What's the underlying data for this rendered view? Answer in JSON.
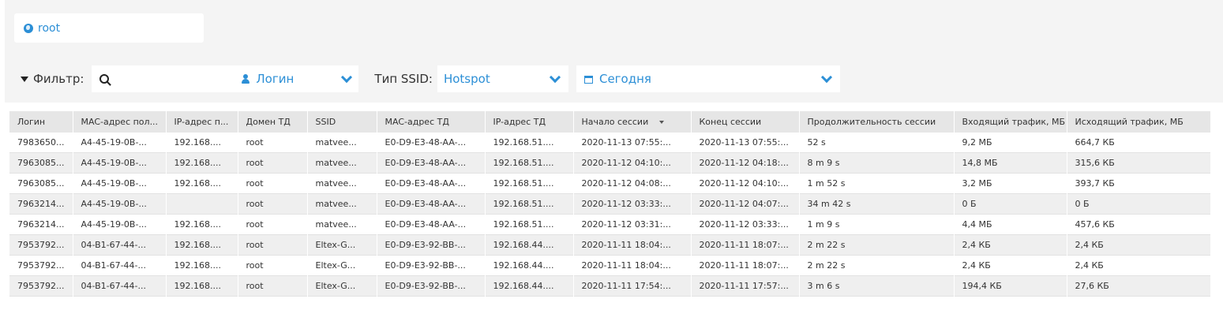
{
  "domain": {
    "label": "root"
  },
  "filter": {
    "label": "Фильтр:",
    "search_value": "",
    "login_selected": "Логин",
    "ssid_label": "Тип SSID:",
    "ssid_selected": "Hotspot",
    "date_selected": "Сегодня"
  },
  "accent_color": "#2c8fd6",
  "table": {
    "columns": [
      "Логин",
      "MAC-адрес пол...",
      "IP-адрес п...",
      "Домен ТД",
      "SSID",
      "MAC-адрес ТД",
      "IP-адрес ТД",
      "Начало сессии",
      "Конец сессии",
      "Продолжительность сессии",
      "Входящий трафик, МБ",
      "Исходящий трафик, МБ"
    ],
    "sorted_column": "Начало сессии",
    "rows": [
      [
        "7983650...",
        "A4-45-19-0B-...",
        "192.168....",
        "root",
        "matvee...",
        "E0-D9-E3-48-AA-...",
        "192.168.51....",
        "2020-11-13 07:55:...",
        "2020-11-13 07:55:...",
        "52 s",
        "9,2 МБ",
        "664,7 КБ"
      ],
      [
        "7963085...",
        "A4-45-19-0B-...",
        "192.168....",
        "root",
        "matvee...",
        "E0-D9-E3-48-AA-...",
        "192.168.51....",
        "2020-11-12 04:10:...",
        "2020-11-12 04:18:...",
        "8 m 9 s",
        "14,8 МБ",
        "315,6 КБ"
      ],
      [
        "7963085...",
        "A4-45-19-0B-...",
        "192.168....",
        "root",
        "matvee...",
        "E0-D9-E3-48-AA-...",
        "192.168.51....",
        "2020-11-12 04:08:...",
        "2020-11-12 04:10:...",
        "1 m 52 s",
        "3,2 МБ",
        "393,7 КБ"
      ],
      [
        "7963214...",
        "A4-45-19-0B-...",
        "",
        "root",
        "matvee...",
        "E0-D9-E3-48-AA-...",
        "192.168.51....",
        "2020-11-12 03:33:...",
        "2020-11-12 04:07:...",
        "34 m 42 s",
        "0 Б",
        "0 Б"
      ],
      [
        "7963214...",
        "A4-45-19-0B-...",
        "192.168....",
        "root",
        "matvee...",
        "E0-D9-E3-48-AA-...",
        "192.168.51....",
        "2020-11-12 03:31:...",
        "2020-11-12 03:33:...",
        "1 m 9 s",
        "4,4 МБ",
        "457,6 КБ"
      ],
      [
        "7953792...",
        "04-B1-67-44-...",
        "192.168....",
        "root",
        "Eltex-G...",
        "E0-D9-E3-92-BB-...",
        "192.168.44....",
        "2020-11-11 18:04:...",
        "2020-11-11 18:07:...",
        "2 m 22 s",
        "2,4 КБ",
        "2,4 КБ"
      ],
      [
        "7953792...",
        "04-B1-67-44-...",
        "192.168....",
        "root",
        "Eltex-G...",
        "E0-D9-E3-92-BB-...",
        "192.168.44....",
        "2020-11-11 18:04:...",
        "2020-11-11 18:07:...",
        "2 m 22 s",
        "2,4 КБ",
        "2,4 КБ"
      ],
      [
        "7953792...",
        "04-B1-67-44-...",
        "192.168....",
        "root",
        "Eltex-G...",
        "E0-D9-E3-92-BB-...",
        "192.168.44....",
        "2020-11-11 17:54:...",
        "2020-11-11 17:57:...",
        "3 m 6 s",
        "194,4 КБ",
        "27,6 КБ"
      ]
    ]
  }
}
